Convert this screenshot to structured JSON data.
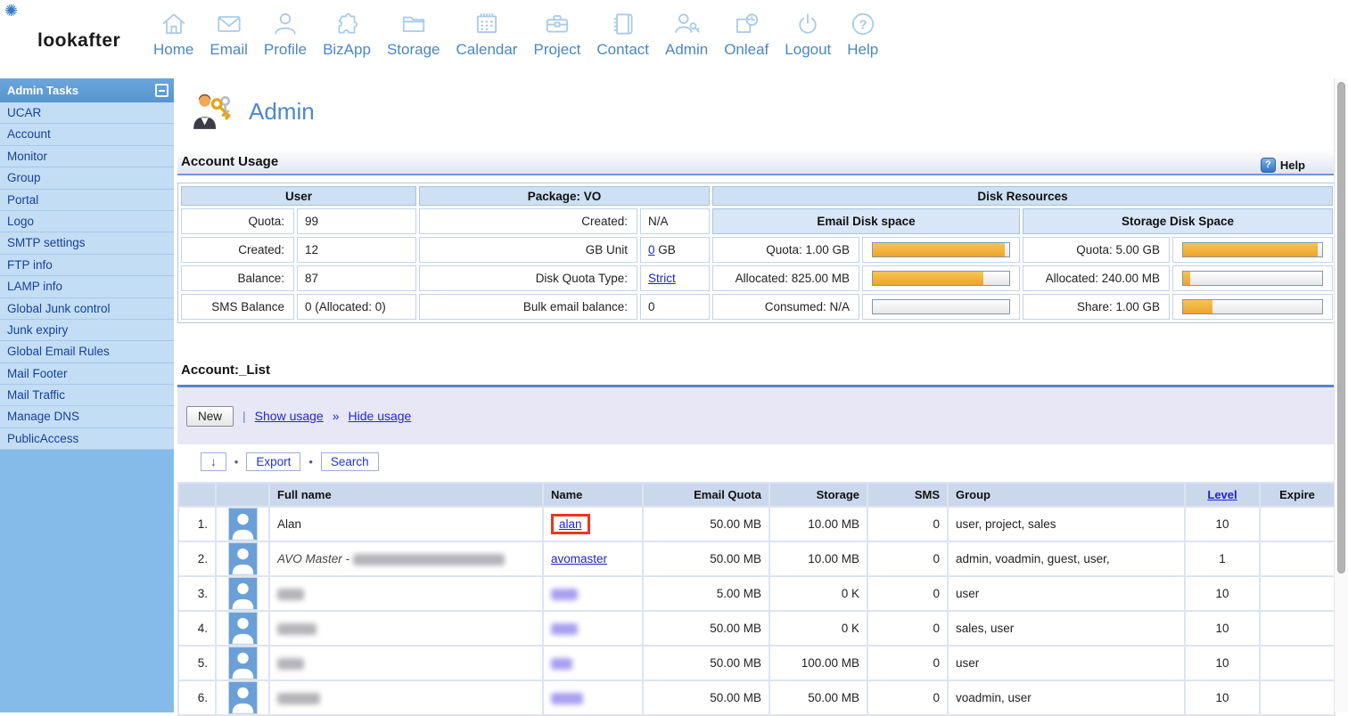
{
  "brand": {
    "logo_text": "lookafter",
    "spark": "✺"
  },
  "nav": {
    "items": [
      {
        "label": "Home",
        "icon": "home-icon"
      },
      {
        "label": "Email",
        "icon": "email-icon"
      },
      {
        "label": "Profile",
        "icon": "profile-icon"
      },
      {
        "label": "BizApp",
        "icon": "bizapp-icon"
      },
      {
        "label": "Storage",
        "icon": "storage-icon"
      },
      {
        "label": "Calendar",
        "icon": "calendar-icon"
      },
      {
        "label": "Project",
        "icon": "project-icon"
      },
      {
        "label": "Contact",
        "icon": "contact-icon"
      },
      {
        "label": "Admin",
        "icon": "admin-icon"
      },
      {
        "label": "Onleaf",
        "icon": "onleaf-icon"
      },
      {
        "label": "Logout",
        "icon": "logout-icon"
      },
      {
        "label": "Help",
        "icon": "help-icon"
      }
    ]
  },
  "sidebar": {
    "title": "Admin Tasks",
    "items": [
      "UCAR",
      "Account",
      "Monitor",
      "Group",
      "Portal",
      "Logo",
      "SMTP settings",
      "FTP info",
      "LAMP info",
      "Global Junk control",
      "Junk expiry",
      "Global Email Rules",
      "Mail Footer",
      "Mail Traffic",
      "Manage DNS",
      "PublicAccess"
    ]
  },
  "page": {
    "title": "Admin"
  },
  "account_usage": {
    "heading": "Account Usage",
    "help_label": "Help",
    "user": {
      "header": "User",
      "rows": [
        {
          "label": "Quota:",
          "value": "99"
        },
        {
          "label": "Created:",
          "value": "12"
        },
        {
          "label": "Balance:",
          "value": "87"
        },
        {
          "label": "SMS Balance",
          "value": "0 (Allocated: 0)"
        }
      ]
    },
    "package": {
      "header": "Package: VO",
      "rows": [
        {
          "label": "Created:",
          "value": "N/A"
        },
        {
          "label": "GB Unit",
          "link": "0",
          "suffix": " GB"
        },
        {
          "label": "Disk Quota Type:",
          "link": "Strict"
        },
        {
          "label": "Bulk email balance:",
          "value": "0"
        }
      ]
    },
    "disk": {
      "header": "Disk Resources",
      "email": {
        "header": "Email Disk space",
        "rows": [
          {
            "label": "Quota: 1.00 GB",
            "percent": 97
          },
          {
            "label": "Allocated: 825.00 MB",
            "percent": 81
          },
          {
            "label": "Consumed: N/A",
            "percent": 0
          }
        ]
      },
      "storage": {
        "header": "Storage Disk Space",
        "rows": [
          {
            "label": "Quota: 5.00 GB",
            "percent": 97
          },
          {
            "label": "Allocated: 240.00 MB",
            "percent": 5
          },
          {
            "label": "Share: 1.00 GB",
            "percent": 21
          }
        ]
      }
    }
  },
  "account_list": {
    "heading": "Account:_List",
    "toolbar": {
      "new_button": "New",
      "separator": "|",
      "show_usage": "Show usage",
      "chevron": "»",
      "hide_usage": "Hide usage"
    },
    "actions": {
      "sort_button": "↓",
      "bullet": "•",
      "export_button": "Export",
      "search_button": "Search"
    },
    "table": {
      "headers": [
        "",
        "",
        "Full name",
        "Name",
        "Email Quota",
        "Storage",
        "SMS",
        "Group",
        "Level",
        "Expire"
      ],
      "rows": [
        {
          "num": "1.",
          "full_name": "Alan",
          "name": "alan",
          "email_quota": "50.00 MB",
          "storage": "10.00 MB",
          "sms": "0",
          "group": "user, project, sales",
          "level": "10",
          "expire": ""
        },
        {
          "num": "2.",
          "full_name": "AVO Master -",
          "name": "avomaster",
          "email_quota": "50.00 MB",
          "storage": "10.00 MB",
          "sms": "0",
          "group": "admin, voadmin, guest, user,",
          "level": "1",
          "expire": ""
        },
        {
          "num": "3.",
          "full_name": "",
          "name": "",
          "email_quota": "5.00 MB",
          "storage": "0 K",
          "sms": "0",
          "group": "user",
          "level": "10",
          "expire": ""
        },
        {
          "num": "4.",
          "full_name": "",
          "name": "",
          "email_quota": "50.00 MB",
          "storage": "0 K",
          "sms": "0",
          "group": "sales, user",
          "level": "10",
          "expire": ""
        },
        {
          "num": "5.",
          "full_name": "",
          "name": "",
          "email_quota": "50.00 MB",
          "storage": "100.00 MB",
          "sms": "0",
          "group": "user",
          "level": "10",
          "expire": ""
        },
        {
          "num": "6.",
          "full_name": "",
          "name": "",
          "email_quota": "50.00 MB",
          "storage": "50.00 MB",
          "sms": "0",
          "group": "voadmin, user",
          "level": "10",
          "expire": ""
        }
      ]
    }
  },
  "colors": {
    "accent_blue": "#5d9ed6",
    "sidebar_item_bg": "#c3ddf4",
    "link_blue": "#2222cc",
    "bar_fill": "#efac36",
    "highlight_red": "#e8391d"
  }
}
